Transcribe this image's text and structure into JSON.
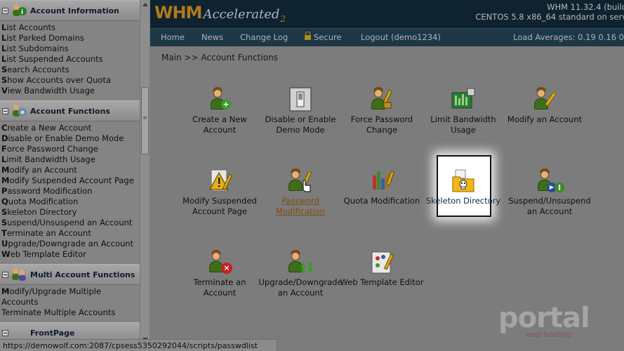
{
  "header": {
    "logo_whm": "WHM",
    "logo_accelerated": "Accelerated",
    "logo_version_mark": "2",
    "version_line1": "WHM 11.32.4 (build",
    "version_line2": "CENTOS 5.8 x86_64 standard on serv"
  },
  "nav": {
    "home": "Home",
    "news": "News",
    "changelog": "Change Log",
    "secure": "Secure",
    "logout": "Logout (demo1234)",
    "load": "Load Averages: 0.19 0.16 0"
  },
  "breadcrumb": "Main >> Account Functions",
  "sidebar": {
    "sections": [
      {
        "title": "Account Information",
        "links": [
          {
            "ini": "L",
            "rest": "ist Accounts"
          },
          {
            "ini": "L",
            "rest": "ist Parked Domains"
          },
          {
            "ini": "L",
            "rest": "ist Subdomains"
          },
          {
            "ini": "L",
            "rest": "ist Suspended Accounts"
          },
          {
            "ini": "S",
            "rest": "earch Accounts"
          },
          {
            "ini": "S",
            "rest": "how Accounts over Quota"
          },
          {
            "ini": "V",
            "rest": "iew Bandwidth Usage"
          }
        ]
      },
      {
        "title": "Account Functions",
        "links": [
          {
            "ini": "C",
            "rest": "reate a New Account"
          },
          {
            "ini": "D",
            "rest": "isable or Enable Demo Mode"
          },
          {
            "ini": "F",
            "rest": "orce Password Change"
          },
          {
            "ini": "L",
            "rest": "imit Bandwidth Usage"
          },
          {
            "ini": "M",
            "rest": "odify an Account"
          },
          {
            "ini": "M",
            "rest": "odify Suspended Account Page"
          },
          {
            "ini": "P",
            "rest": "assword Modification"
          },
          {
            "ini": "Q",
            "rest": "uota Modification"
          },
          {
            "ini": "S",
            "rest": "keleton Directory"
          },
          {
            "ini": "S",
            "rest": "uspend/Unsuspend an Account"
          },
          {
            "ini": "T",
            "rest": "erminate an Account"
          },
          {
            "ini": "U",
            "rest": "pgrade/Downgrade an Account"
          },
          {
            "ini": "W",
            "rest": "eb Template Editor"
          }
        ]
      },
      {
        "title": "Multi Account Functions",
        "links": [
          {
            "ini": "M",
            "rest": "odify/Upgrade Multiple"
          },
          {
            "ini": "A",
            "rest": "ccounts"
          },
          {
            "ini": "T",
            "rest": "erminate Multiple Accounts"
          }
        ]
      },
      {
        "title": "FrontPage",
        "links": []
      }
    ]
  },
  "tiles": {
    "create": "Create a New Account",
    "demo": "Disable or Enable Demo Mode",
    "force": "Force Password Change",
    "limit": "Limit Bandwidth Usage",
    "modify": "Modify an Account",
    "modsusp": "Modify Suspended Account Page",
    "password": "Password Modification",
    "quota": "Quota Modification",
    "skeleton": "Skeleton Directory",
    "suspend": "Suspend/Unsuspend an Account",
    "terminate": "Terminate an Account",
    "upgrade": "Upgrade/Downgrade an Account",
    "webtemplate": "Web Template Editor"
  },
  "statusbar": "https://demowolf.com:2087/cpsess5350292044/scripts/passwdlist",
  "watermark": {
    "brand": "portal",
    "tagline": "web hosting"
  },
  "colors": {
    "header_bg": "#0f2230",
    "nav_bg": "#1e3746",
    "logo_orange": "#b07a1a",
    "overlay_gray": "#7c7c7c",
    "link_brown": "#7d4d10"
  }
}
